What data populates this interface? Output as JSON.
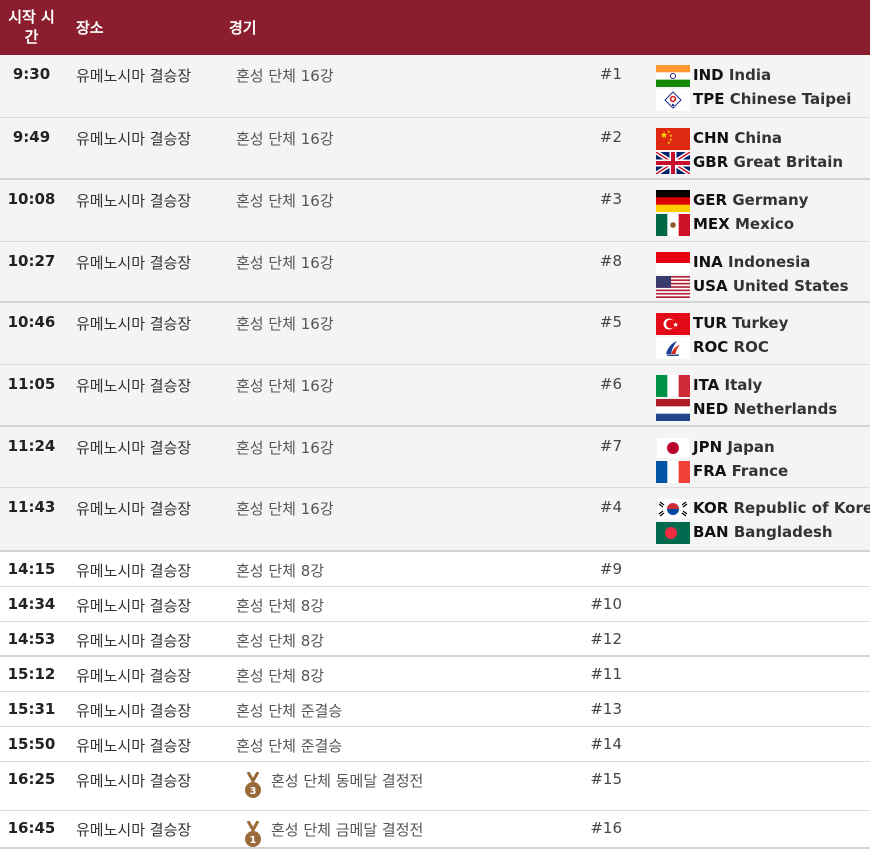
{
  "header": {
    "time": "시작 시간",
    "time_line1": "시작 시",
    "time_line2": "간",
    "venue": "장소",
    "event": "경기"
  },
  "rows": [
    {
      "time": "9:30",
      "venue": "유메노시마 결승장",
      "event": "혼성 단체 16강",
      "match": "#1",
      "teams": [
        {
          "flag": "india-flag",
          "code": "IND",
          "name": "India"
        },
        {
          "flag": "chinese-taipei-flag",
          "code": "TPE",
          "name": "Chinese Taipei"
        }
      ]
    },
    {
      "time": "9:49",
      "venue": "유메노시마 결승장",
      "event": "혼성 단체 16강",
      "match": "#2",
      "teams": [
        {
          "flag": "china-flag",
          "code": "CHN",
          "name": "China"
        },
        {
          "flag": "great-britain-flag",
          "code": "GBR",
          "name": "Great Britain"
        }
      ]
    },
    {
      "time": "10:08",
      "venue": "유메노시마 결승장",
      "event": "혼성 단체 16강",
      "match": "#3",
      "teams": [
        {
          "flag": "germany-flag",
          "code": "GER",
          "name": "Germany"
        },
        {
          "flag": "mexico-flag",
          "code": "MEX",
          "name": "Mexico"
        }
      ]
    },
    {
      "time": "10:27",
      "venue": "유메노시마 결승장",
      "event": "혼성 단체 16강",
      "match": "#8",
      "teams": [
        {
          "flag": "indonesia-flag",
          "code": "INA",
          "name": "Indonesia"
        },
        {
          "flag": "united-states-flag",
          "code": "USA",
          "name": "United States"
        }
      ]
    },
    {
      "time": "10:46",
      "venue": "유메노시마 결승장",
      "event": "혼성 단체 16강",
      "match": "#5",
      "teams": [
        {
          "flag": "turkey-flag",
          "code": "TUR",
          "name": "Turkey"
        },
        {
          "flag": "roc-flag",
          "code": "ROC",
          "name": "ROC"
        }
      ]
    },
    {
      "time": "11:05",
      "venue": "유메노시마 결승장",
      "event": "혼성 단체 16강",
      "match": "#6",
      "teams": [
        {
          "flag": "italy-flag",
          "code": "ITA",
          "name": "Italy"
        },
        {
          "flag": "netherlands-flag",
          "code": "NED",
          "name": "Netherlands"
        }
      ]
    },
    {
      "time": "11:24",
      "venue": "유메노시마 결승장",
      "event": "혼성 단체 16강",
      "match": "#7",
      "teams": [
        {
          "flag": "japan-flag",
          "code": "JPN",
          "name": "Japan"
        },
        {
          "flag": "france-flag",
          "code": "FRA",
          "name": "France"
        }
      ]
    },
    {
      "time": "11:43",
      "venue": "유메노시마 결승장",
      "event": "혼성 단체 16강",
      "match": "#4",
      "teams": [
        {
          "flag": "korea-flag",
          "code": "KOR",
          "name": "Republic of Korea"
        },
        {
          "flag": "bangladesh-flag",
          "code": "BAN",
          "name": "Bangladesh"
        }
      ]
    },
    {
      "time": "14:15",
      "venue": "유메노시마 결승장",
      "event": "혼성 단체 8강",
      "match": "#9"
    },
    {
      "time": "14:34",
      "venue": "유메노시마 결승장",
      "event": "혼성 단체 8강",
      "match": "#10"
    },
    {
      "time": "14:53",
      "venue": "유메노시마 결승장",
      "event": "혼성 단체 8강",
      "match": "#12"
    },
    {
      "time": "15:12",
      "venue": "유메노시마 결승장",
      "event": "혼성 단체 8강",
      "match": "#11"
    },
    {
      "time": "15:31",
      "venue": "유메노시마 결승장",
      "event": "혼성 단체 준결승",
      "match": "#13"
    },
    {
      "time": "15:50",
      "venue": "유메노시마 결승장",
      "event": "혼성 단체 준결승",
      "match": "#14"
    },
    {
      "time": "16:25",
      "venue": "유메노시마 결승장",
      "event": "혼성 단체 동메달 결정전",
      "match": "#15",
      "medal": "bronze-medal-icon",
      "medal_number": "3"
    },
    {
      "time": "16:45",
      "venue": "유메노시마 결승장",
      "event": "혼성 단체 금메달 결정전",
      "match": "#16",
      "medal": "gold-medal-icon",
      "medal_number": "1"
    }
  ],
  "colors": {
    "header_bg": "#8a1e2e",
    "row_alt": "#f4f4f4",
    "medal": "#9b6a3a"
  }
}
